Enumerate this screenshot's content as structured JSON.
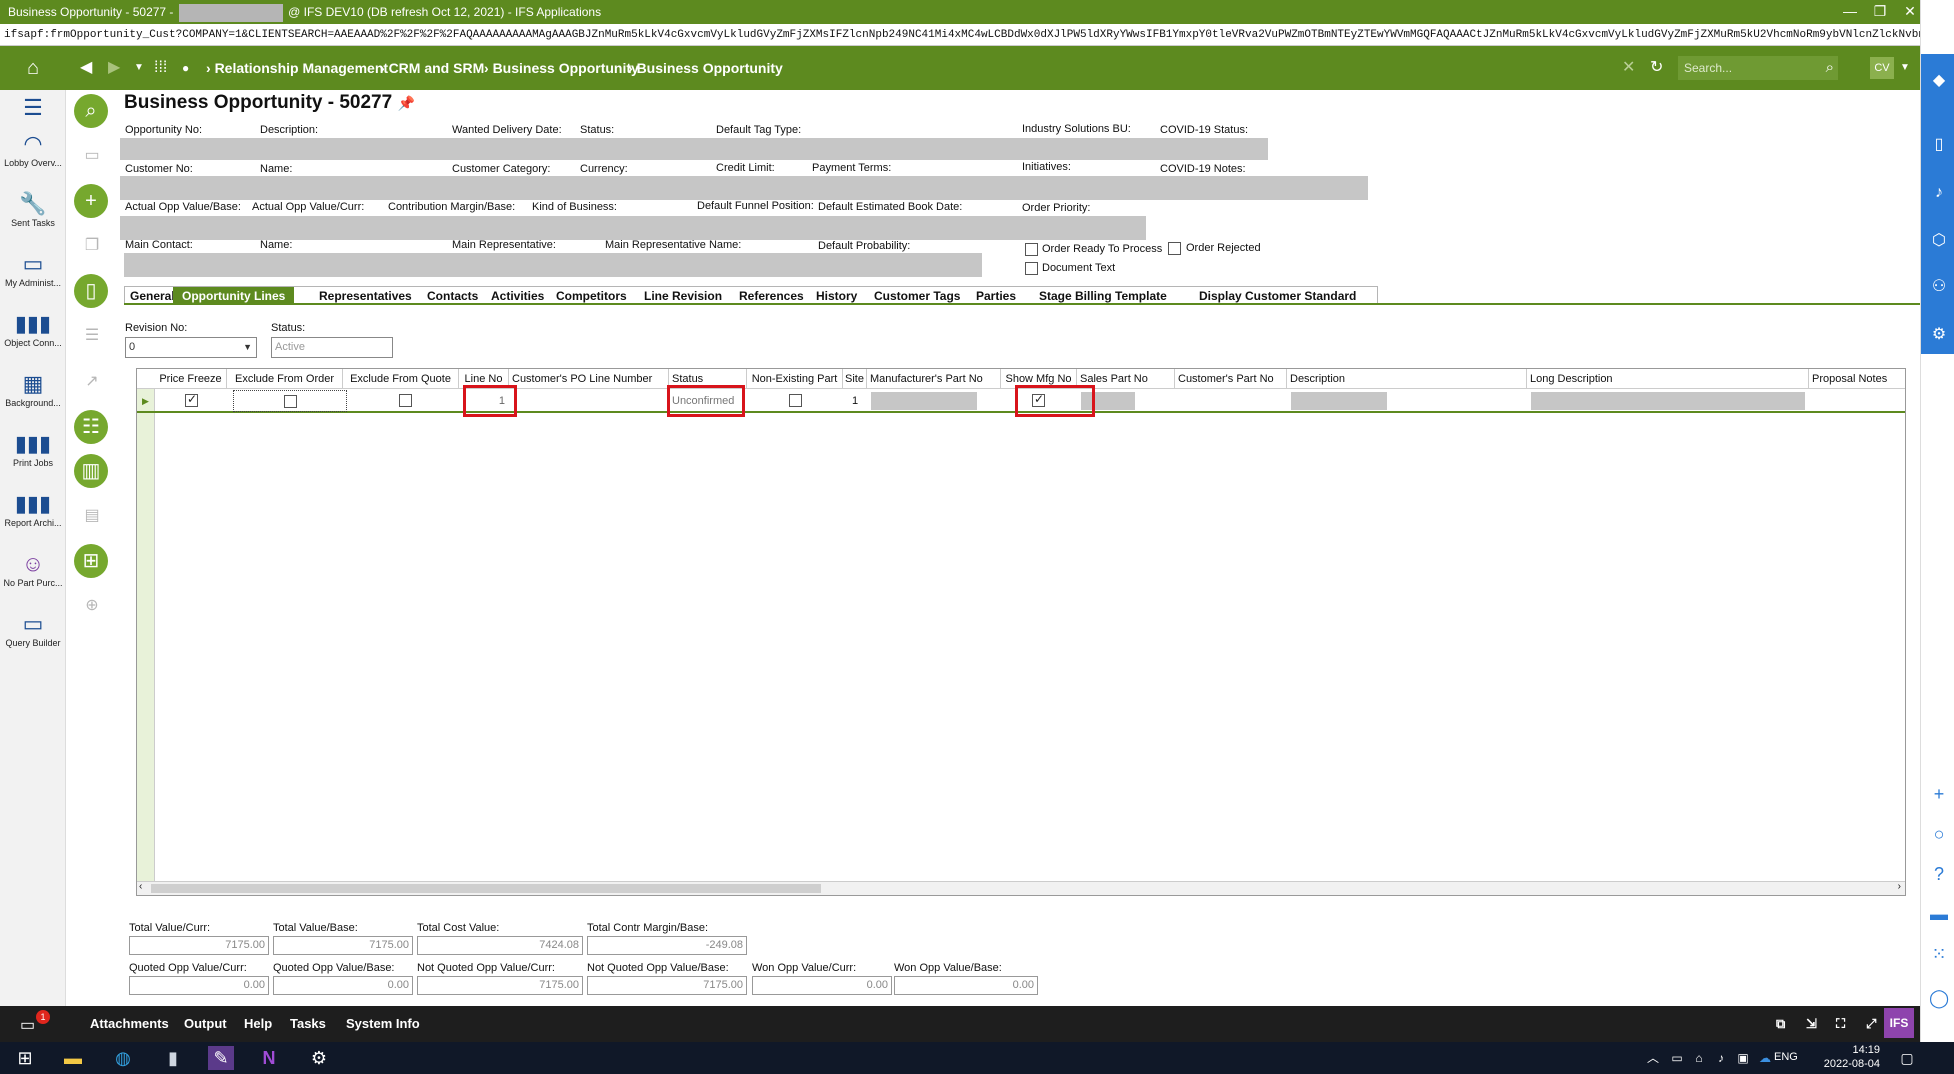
{
  "window": {
    "title_prefix": "Business Opportunity - 50277 -",
    "title_suffix": "@ IFS DEV10 (DB refresh Oct 12, 2021) - IFS Applications",
    "url": "ifsapf:frmOpportunity_Cust?COMPANY=1&CLIENTSEARCH=AAEAAAD%2F%2F%2F%2FAQAAAAAAAAAMAgAAAGBJZnMuRm5kLkV4cGxvcmVyLkludGVyZmFjZXMsIFZlcnNpb249NC41Mi4xMC4wLCBDdWx0dXJlPW5ldXRyYWwsIFB1YmxpY0tleVRva2VuPWZmOTBmNTEyZTEwYWVmMGQFAQAAACtJZnMuRm5kLkV4cGxvcmVyLkludGVyZmFjZXMuRm5kU2VhcmNoRm9ybVNlcnZlckNvbnRlbnRvBAAA"
  },
  "nav": {
    "breadcrumb": [
      "Relationship Management",
      "CRM and SRM",
      "Business Opportunity",
      "Business Opportunity"
    ],
    "search_placeholder": "Search...",
    "avatar": "CV"
  },
  "leftnav": [
    {
      "label": "Lobby Overv...",
      "icon": "gauge-icon"
    },
    {
      "label": "Sent Tasks",
      "icon": "wrench-icon"
    },
    {
      "label": "My Administ...",
      "icon": "monitor-icon"
    },
    {
      "label": "Object Conn...",
      "icon": "bar-chart-icon"
    },
    {
      "label": "Background...",
      "icon": "table-icon"
    },
    {
      "label": "Print Jobs",
      "icon": "bar-chart-icon"
    },
    {
      "label": "Report Archi...",
      "icon": "bar-chart-icon"
    },
    {
      "label": "No Part Purc...",
      "icon": "smiley-icon"
    },
    {
      "label": "Query Builder",
      "icon": "window-icon"
    }
  ],
  "header": {
    "title": "Business Opportunity - 50277",
    "labels": {
      "opportunity_no": "Opportunity No:",
      "description": "Description:",
      "wanted_delivery_date": "Wanted Delivery Date:",
      "status": "Status:",
      "default_tag_type": "Default Tag Type:",
      "industry_solutions_bu": "Industry Solutions BU:",
      "covid_status": "COVID-19 Status:",
      "customer_no": "Customer No:",
      "name": "Name:",
      "customer_category": "Customer Category:",
      "currency": "Currency:",
      "credit_limit": "Credit Limit:",
      "payment_terms": "Payment Terms:",
      "initiatives": "Initiatives:",
      "covid_notes": "COVID-19 Notes:",
      "actual_opp_value_base": "Actual Opp Value/Base:",
      "actual_opp_value_curr": "Actual Opp Value/Curr:",
      "contribution_margin_base": "Contribution Margin/Base:",
      "kind_of_business": "Kind of Business:",
      "default_funnel_position": "Default Funnel Position:",
      "default_estimated_book_date": "Default Estimated Book Date:",
      "order_priority": "Order Priority:",
      "main_contact": "Main Contact:",
      "name2": "Name:",
      "main_representative": "Main Representative:",
      "main_representative_name": "Main Representative Name:",
      "default_probability": "Default Probability:"
    },
    "checkboxes": {
      "order_ready": "Order Ready To Process",
      "order_rejected": "Order Rejected",
      "document_text": "Document Text"
    }
  },
  "tabs": [
    "General",
    "Opportunity Lines",
    "Representatives",
    "Contacts",
    "Activities",
    "Competitors",
    "Line Revision",
    "References",
    "History",
    "Customer Tags",
    "Parties",
    "Stage Billing Template",
    "Display Customer Standard"
  ],
  "revision": {
    "revision_label": "Revision No:",
    "revision_value": "0",
    "status_label": "Status:",
    "status_value": "Active"
  },
  "grid": {
    "columns": [
      "Price Freeze",
      "Exclude From Order",
      "Exclude From Quote",
      "Line No",
      "Customer's PO Line Number",
      "Status",
      "Non-Existing Part",
      "Site",
      "Manufacturer's Part No",
      "Show Mfg No",
      "Sales Part No",
      "Customer's Part No",
      "Description",
      "Long Description",
      "Proposal Notes"
    ],
    "row": {
      "line_no": "1",
      "status": "Unconfirmed",
      "site": "1"
    }
  },
  "totals": {
    "row1": [
      {
        "label": "Total Value/Curr:",
        "value": "7175.00"
      },
      {
        "label": "Total Value/Base:",
        "value": "7175.00"
      },
      {
        "label": "Total Cost Value:",
        "value": "7424.08"
      },
      {
        "label": "Total Contr Margin/Base:",
        "value": "-249.08"
      }
    ],
    "row2": [
      {
        "label": "Quoted Opp Value/Curr:",
        "value": "0.00"
      },
      {
        "label": "Quoted Opp Value/Base:",
        "value": "0.00"
      },
      {
        "label": "Not Quoted Opp Value/Curr:",
        "value": "7175.00"
      },
      {
        "label": "Not Quoted Opp Value/Base:",
        "value": "7175.00"
      },
      {
        "label": "Won Opp Value/Curr:",
        "value": "0.00"
      },
      {
        "label": "Won Opp Value/Base:",
        "value": "0.00"
      }
    ]
  },
  "bottombar": {
    "badge": "1",
    "items": [
      "Attachments",
      "Output",
      "Help",
      "Tasks",
      "System Info"
    ]
  },
  "taskbar": {
    "lang": "ENG",
    "time": "14:19",
    "date": "2022-08-04"
  }
}
